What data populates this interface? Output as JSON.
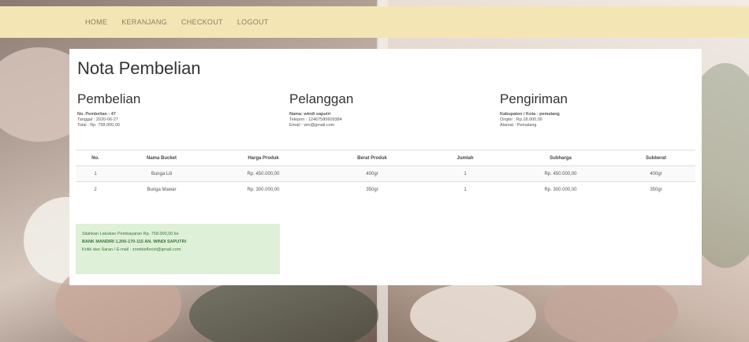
{
  "nav": {
    "items": [
      "HOME",
      "KERANJANG",
      "CHECKOUT",
      "LOGOUT"
    ]
  },
  "page": {
    "title": "Nota Pembelian"
  },
  "pembelian": {
    "heading": "Pembelian",
    "no": "No. Pembelian : 47",
    "tanggal": "Tanggal : 2020-06-27",
    "total": "Total : Rp. 758.000,00"
  },
  "pelanggan": {
    "heading": "Pelanggan",
    "nama": "Nama: windi saputri",
    "telepon": "Telepon : 12467580609384",
    "email": "Email : win@gmail.com"
  },
  "pengiriman": {
    "heading": "Pengiriman",
    "kabupaten": "Kabupaten / Kota : pemalang",
    "ongkir": "Ongkir : Rp.18.000,00",
    "alamat": "Alamat : Pemalang"
  },
  "table": {
    "headers": [
      "No.",
      "Nama Bucket",
      "Harga Produk",
      "Berat Produk",
      "Jumlah",
      "Subharga",
      "Subberat"
    ],
    "rows": [
      [
        "1",
        "Bunga Lili",
        "Rp. 450.000,00",
        "400gr",
        "1",
        "Rp. 450.000,00",
        "400gr"
      ],
      [
        "2",
        "Bunga Mawar",
        "Rp. 300.000,00",
        "350gr",
        "1",
        "Rp. 300.000,00",
        "350gr"
      ]
    ]
  },
  "alert": {
    "line1": "Silahkan Lakukan Pembayaran Rp. 758.000,00 ke",
    "line2": "BANK MANDIRI 1.200-170-115 AN. WINDI SAPUTRI",
    "line3": "Kritik dan Saran / E-mail : zombieflorist@gmail.com"
  }
}
